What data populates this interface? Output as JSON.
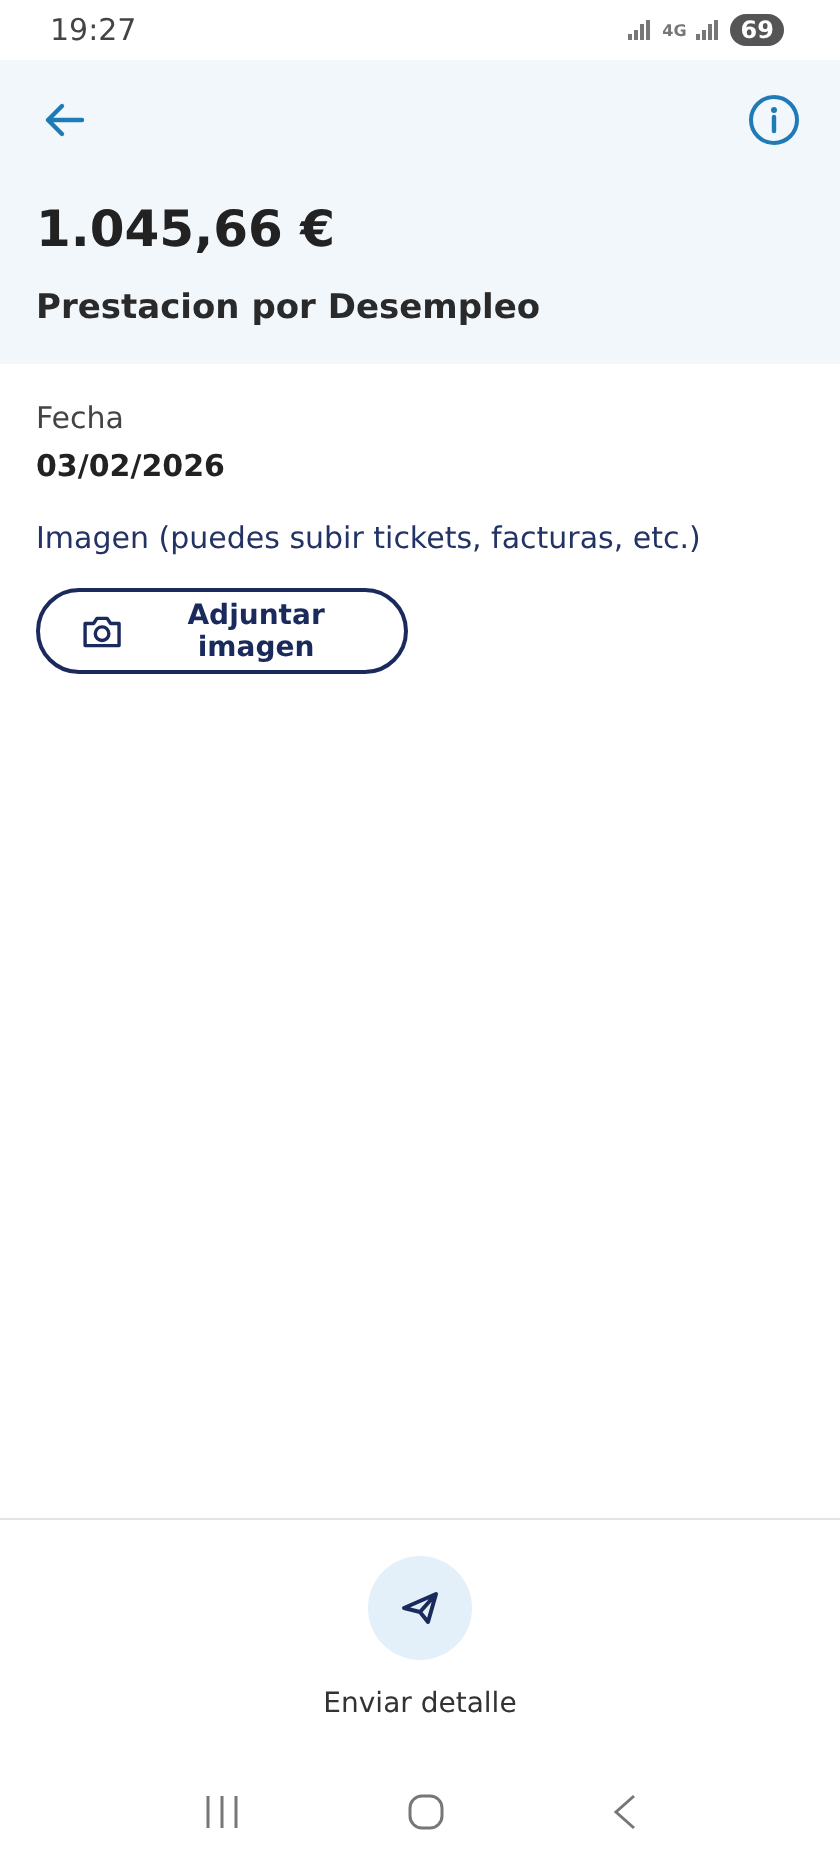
{
  "status_bar": {
    "time": "19:27",
    "network": "4G",
    "battery": "69"
  },
  "header": {
    "amount": "1.045,66 €",
    "title": "Prestacion por Desempleo"
  },
  "details": [
    {
      "label": "Fecha",
      "value": "03/02/2026"
    }
  ],
  "image_section": {
    "hint": "Imagen (puedes subir tickets, facturas, etc.)",
    "button": "Adjuntar imagen"
  },
  "footer": {
    "action": "Enviar detalle"
  }
}
